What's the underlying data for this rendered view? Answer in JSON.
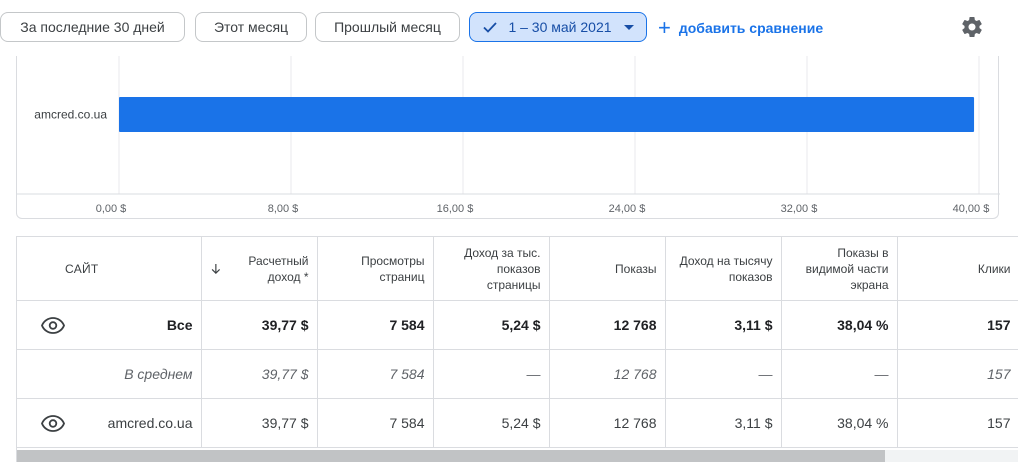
{
  "filters": {
    "last30": "За последние 30 дней",
    "this_month": "Этот месяц",
    "last_month": "Прошлый месяц",
    "selected_range": "1 – 30 май 2021",
    "add_comparison": "добавить сравнение"
  },
  "icons": {
    "settings": "gear-icon",
    "check": "check-icon",
    "dropdown": "caret-down-icon",
    "add": "plus-icon",
    "visibility": "eye-icon",
    "sort": "arrow-down-icon"
  },
  "colors": {
    "accent": "#1a73e8",
    "selected_chip_bg": "#d2e3fc",
    "bar": "#1a73e8"
  },
  "chart_data": {
    "type": "bar",
    "orientation": "horizontal",
    "categories": [
      "amcred.co.ua"
    ],
    "values": [
      39.77
    ],
    "xlim": [
      0,
      40
    ],
    "x_ticks": [
      "0,00 $",
      "8,00 $",
      "16,00 $",
      "24,00 $",
      "32,00 $",
      "40,00 $"
    ],
    "x_tick_values": [
      0,
      8,
      16,
      24,
      32,
      40
    ],
    "grid": true
  },
  "table": {
    "columns": {
      "site": "САЙТ",
      "est_earnings": "Расчетный доход *",
      "page_views": "Просмотры страниц",
      "page_rpm": "Доход за тыс. показов страницы",
      "impressions": "Показы",
      "impression_rpm": "Доход на тысячу показов",
      "viewability": "Показы в видимой части экрана",
      "clicks": "Клики"
    },
    "rows": [
      {
        "name": "Все",
        "est_earnings": "39,77 $",
        "page_views": "7 584",
        "page_rpm": "5,24 $",
        "impressions": "12 768",
        "impression_rpm": "3,11 $",
        "viewability": "38,04 %",
        "clicks": "157"
      },
      {
        "name": "В среднем",
        "est_earnings": "39,77 $",
        "page_views": "7 584",
        "page_rpm": "—",
        "impressions": "12 768",
        "impression_rpm": "—",
        "viewability": "—",
        "clicks": "157"
      },
      {
        "name": "amcred.co.ua",
        "est_earnings": "39,77 $",
        "page_views": "7 584",
        "page_rpm": "5,24 $",
        "impressions": "12 768",
        "impression_rpm": "3,11 $",
        "viewability": "38,04 %",
        "clicks": "157"
      }
    ]
  }
}
